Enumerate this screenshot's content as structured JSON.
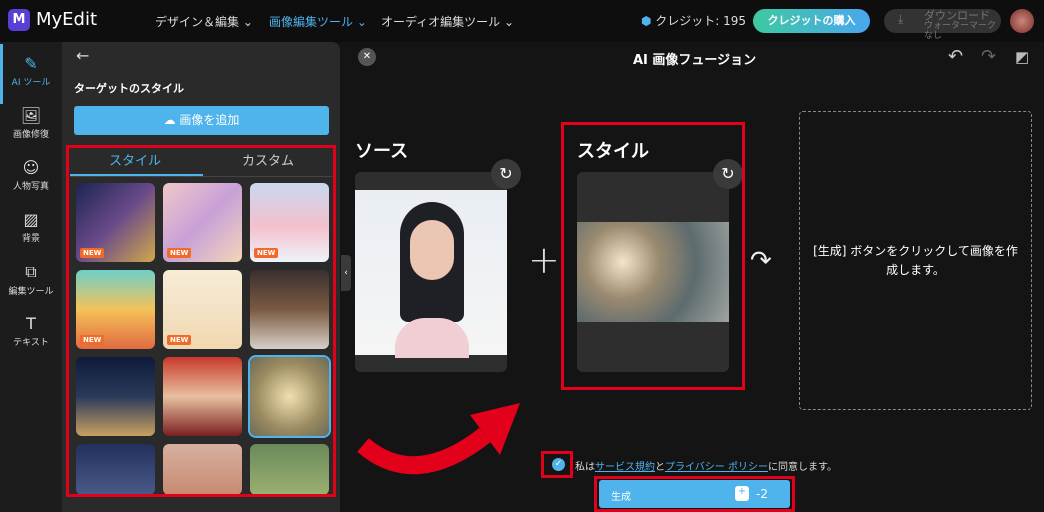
{
  "header": {
    "logo_letter": "M",
    "brand": "MyEdit",
    "nav": [
      "デザイン＆編集 ⌄",
      "画像編集ツール ⌄",
      "オーディオ編集ツール ⌄"
    ],
    "credits": "クレジット: 195",
    "buy": "クレジットの購入",
    "download": "ダウンロード",
    "download_sub": "ウォーターマークなし"
  },
  "rail": [
    {
      "icon": "✎",
      "label": "AI ツール"
    },
    {
      "icon": "🖼",
      "label": "画像修復"
    },
    {
      "icon": "☺",
      "label": "人物写真"
    },
    {
      "icon": "▨",
      "label": "背景"
    },
    {
      "icon": "⧉",
      "label": "編集ツール"
    },
    {
      "icon": "T",
      "label": "テキスト"
    }
  ],
  "panel": {
    "back": "←",
    "title": "ターゲットのスタイル",
    "add": "画像を追加",
    "tabs": [
      "スタイル",
      "カスタム"
    ],
    "new_badge": "NEW"
  },
  "main": {
    "title": "AI 画像フュージョン",
    "source": "ソース",
    "style": "スタイル",
    "plus": "+",
    "result": "[生成] ボタンをクリックして画像を作成します。",
    "agree_pre": "私は",
    "terms": "サービス規約",
    "and": "と",
    "privacy": "プライバシー ポリシー",
    "agree_post": "に同意します。",
    "generate": "生成",
    "cost": "-2"
  },
  "colors": {
    "accent": "#4fb3ec",
    "highlight": "#e3001b"
  }
}
